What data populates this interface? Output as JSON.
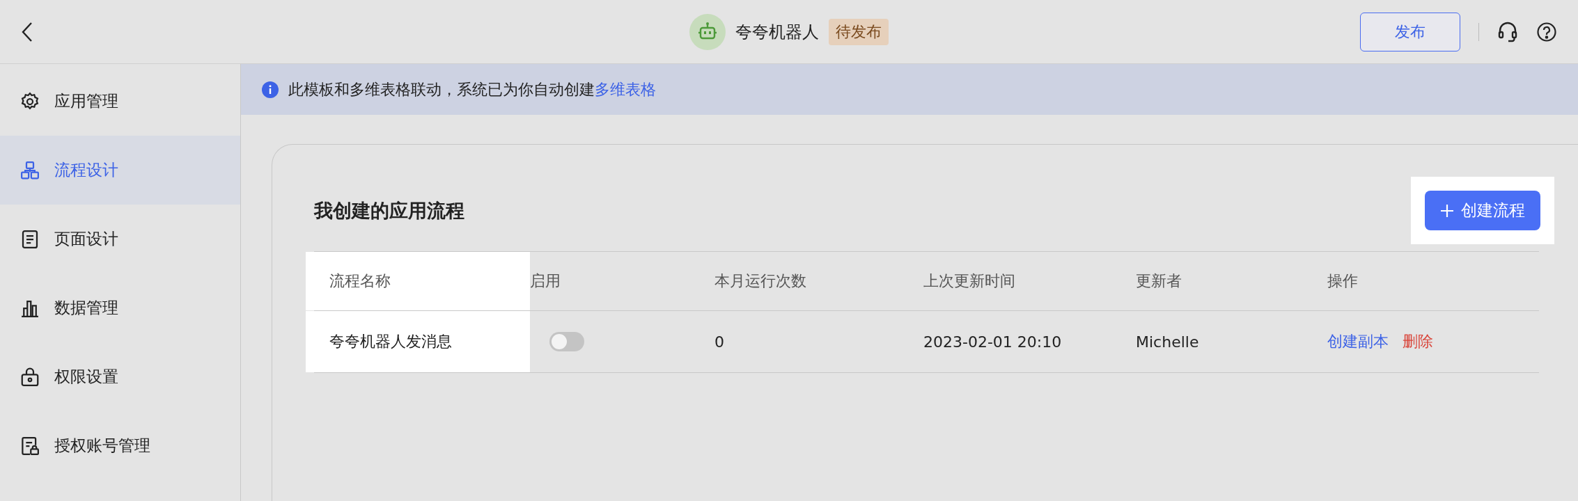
{
  "topbar": {
    "title": "夸夸机器人",
    "badge": "待发布",
    "publish_button": "发布"
  },
  "sidebar": {
    "items": [
      {
        "label": "应用管理",
        "selected": false
      },
      {
        "label": "流程设计",
        "selected": true
      },
      {
        "label": "页面设计",
        "selected": false
      },
      {
        "label": "数据管理",
        "selected": false
      },
      {
        "label": "权限设置",
        "selected": false
      },
      {
        "label": "授权账号管理",
        "selected": false
      }
    ]
  },
  "banner": {
    "text": "此模板和多维表格联动，系统已为你自动创建",
    "link": "多维表格"
  },
  "section": {
    "title": "我创建的应用流程",
    "create_button": "创建流程"
  },
  "table": {
    "columns": [
      "流程名称",
      "启用",
      "本月运行次数",
      "上次更新时间",
      "更新者",
      "操作"
    ],
    "rows": [
      {
        "name": "夸夸机器人发消息",
        "enabled": false,
        "runs": "0",
        "updated": "2023-02-01 20:10",
        "updater": "Michelle",
        "actions": [
          {
            "label": "创建副本",
            "kind": "normal"
          },
          {
            "label": "删除",
            "kind": "danger"
          }
        ]
      }
    ]
  }
}
